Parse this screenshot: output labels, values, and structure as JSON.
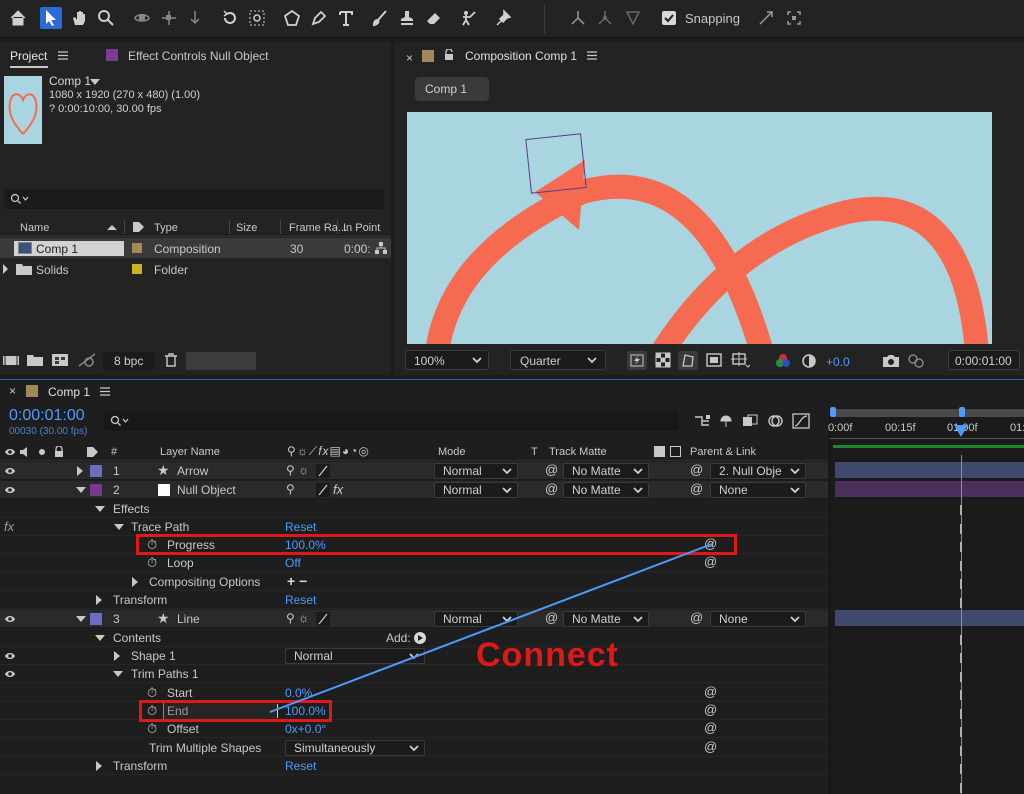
{
  "toolbar": {
    "snapping_label": "Snapping",
    "snapping_checked": true
  },
  "project": {
    "tab_label": "Project",
    "effect_tab_label": "Effect Controls Null Object",
    "comp_name": "Comp 1",
    "comp_dims": "1080 x 1920  (270 x 480) (1.00)",
    "comp_duration": "? 0:00:10:00, 30.00 fps",
    "columns": [
      "Name",
      "Type",
      "Size",
      "Frame Ra...",
      "In Point"
    ],
    "items": [
      {
        "name": "Comp 1",
        "type": "Composition",
        "size": "",
        "fps": "30",
        "in": "0:00:",
        "color": "#a08a5a"
      },
      {
        "name": "Solids",
        "type": "Folder",
        "size": "",
        "fps": "",
        "in": "",
        "color": "#c8b420"
      }
    ],
    "bpc_label": "8 bpc"
  },
  "composition": {
    "tab_label": "Composition Comp 1",
    "flow_label": "Comp 1",
    "zoom": "100%",
    "resolution": "Quarter",
    "exposure": "+0.0",
    "timecode": "0:00:01:00"
  },
  "timeline": {
    "tab_label": "Comp 1",
    "timecode": "0:00:01:00",
    "frame_info": "00030 (30.00 fps)",
    "columns": {
      "num": "#",
      "layer_name": "Layer Name",
      "mode": "Mode",
      "t": "T",
      "track_matte": "Track Matte",
      "parent": "Parent & Link"
    },
    "ruler": [
      "0:00f",
      "00:15f",
      "01:00f",
      "01:"
    ],
    "layers": [
      {
        "num": "1",
        "name": "Arrow",
        "mode": "Normal",
        "matte": "No Matte",
        "parent": "2. Null Obje",
        "color": "#6b6fc4"
      },
      {
        "num": "2",
        "name": "Null Object",
        "mode": "Normal",
        "matte": "No Matte",
        "parent": "None",
        "color": "#7a3a8a"
      },
      {
        "num": "3",
        "name": "Line",
        "mode": "Normal",
        "matte": "No Matte",
        "parent": "None",
        "color": "#6b6fc4"
      }
    ],
    "props": {
      "effects": "Effects",
      "trace_path": "Trace Path",
      "reset": "Reset",
      "progress": "Progress",
      "progress_val": "100.0%",
      "loop": "Loop",
      "loop_val": "Off",
      "compositing": "Compositing Options",
      "compositing_val": "+ −",
      "transform": "Transform",
      "contents": "Contents",
      "add": "Add:",
      "shape1": "Shape 1",
      "shape1_mode": "Normal",
      "trim": "Trim Paths 1",
      "start": "Start",
      "start_val": "0.0%",
      "end": "End",
      "end_val": "100.0%",
      "offset": "Offset",
      "offset_val": "0x+0.0°",
      "trim_multi": "Trim Multiple Shapes",
      "trim_multi_val": "Simultaneously",
      "fx": "fx"
    }
  },
  "annotation": {
    "text": "Connect"
  },
  "colors": {
    "accent_blue": "#4d9bff",
    "highlight_red": "#e01818",
    "canvas_bg": "#a9d5e0",
    "shape_coral": "#f56a50"
  }
}
